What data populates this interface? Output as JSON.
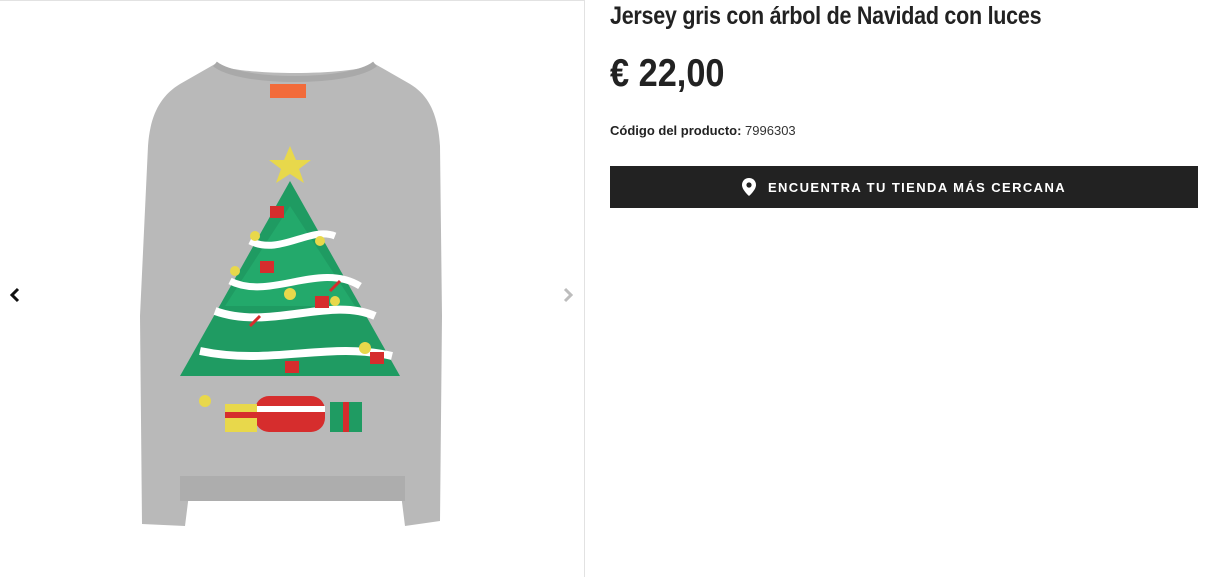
{
  "gallery": {
    "prev_icon": "chevron-left-icon",
    "next_icon": "chevron-right-icon",
    "image_alt": "Jersey gris con árbol de Navidad con luces"
  },
  "product": {
    "title": "Jersey gris con árbol de Navidad con luces",
    "price": "€ 22,00",
    "code_label": "Código del producto:",
    "code_value": "7996303"
  },
  "store_button": {
    "label": "ENCUENTRA TU TIENDA MÁS CERCANA",
    "icon": "map-pin-icon"
  },
  "colors": {
    "button_bg": "#222222",
    "sweater_grey": "#b9b9b9",
    "tree_green": "#1f9b62",
    "label_orange": "#f26b3a"
  }
}
